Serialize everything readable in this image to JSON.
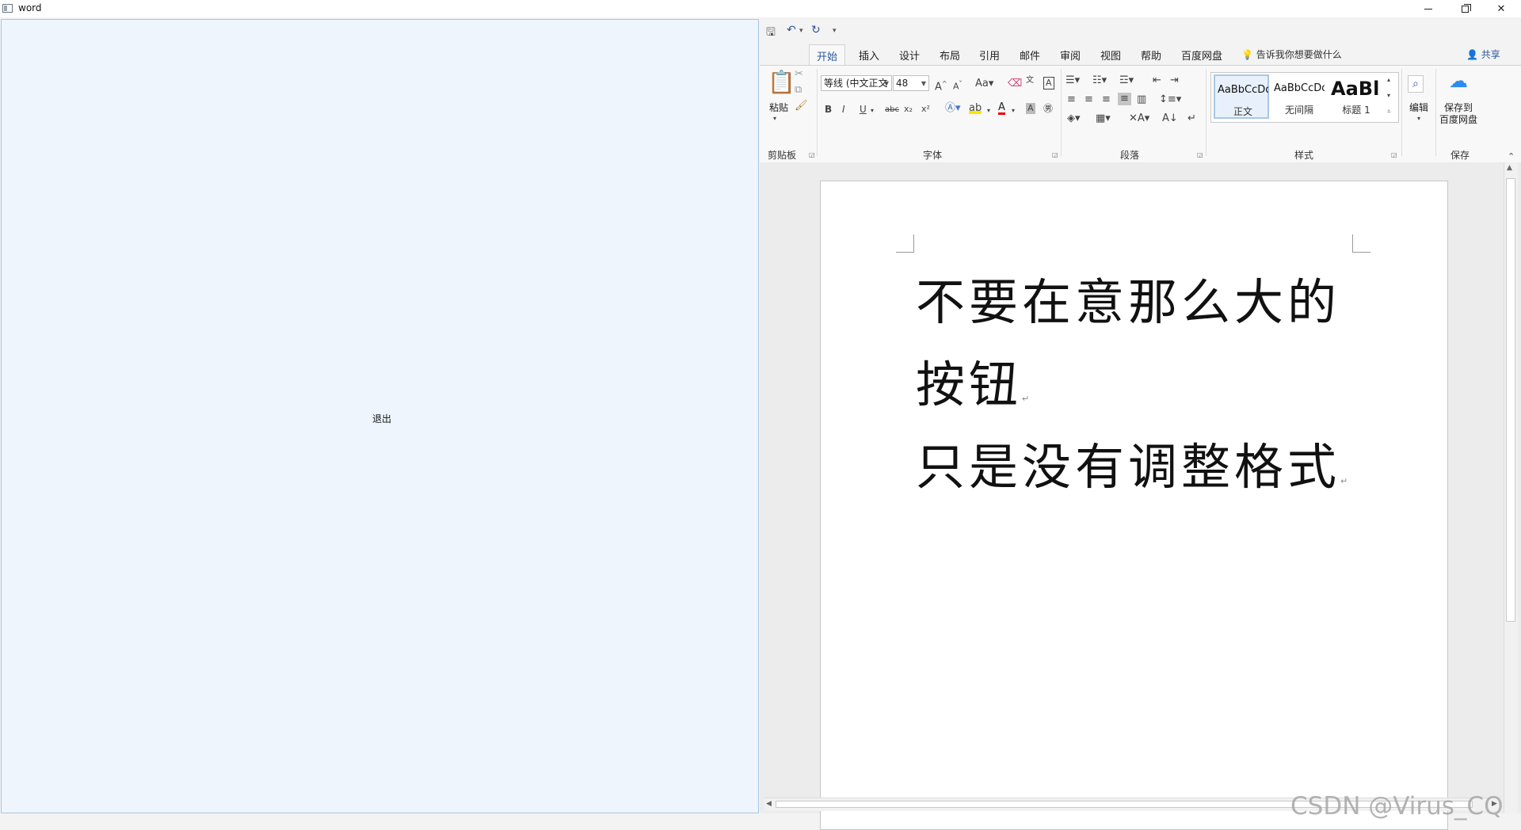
{
  "window": {
    "title": "word"
  },
  "left_panel": {
    "exit_button_label": "退出"
  },
  "word": {
    "tabs": [
      "开始",
      "插入",
      "设计",
      "布局",
      "引用",
      "邮件",
      "审阅",
      "视图",
      "帮助",
      "百度网盘"
    ],
    "active_tab": "开始",
    "tell_me": "告诉我你想要做什么",
    "share": "共享",
    "ribbon": {
      "clipboard": {
        "paste": "粘贴",
        "label": "剪贴板"
      },
      "font": {
        "name": "等线 (中文正文",
        "size": "48",
        "label": "字体"
      },
      "paragraph": {
        "label": "段落"
      },
      "styles": {
        "label": "样式",
        "items": [
          {
            "sample": "AaBbCcDd",
            "name": "正文"
          },
          {
            "sample": "AaBbCcDd",
            "name": "无间隔"
          },
          {
            "sample": "AaBl",
            "name": "标题 1"
          }
        ]
      },
      "editing": {
        "label": "编辑"
      },
      "save": {
        "line1": "保存到",
        "line2": "百度网盘",
        "label": "保存"
      }
    },
    "document": {
      "paragraphs": [
        "不要在意那么大的",
        "按钮",
        "只是没有调整格式"
      ]
    }
  },
  "watermark": "CSDN @Virus_CQ",
  "colors": {
    "accent": "#2b579a",
    "panel_bg": "#eef5fc"
  }
}
